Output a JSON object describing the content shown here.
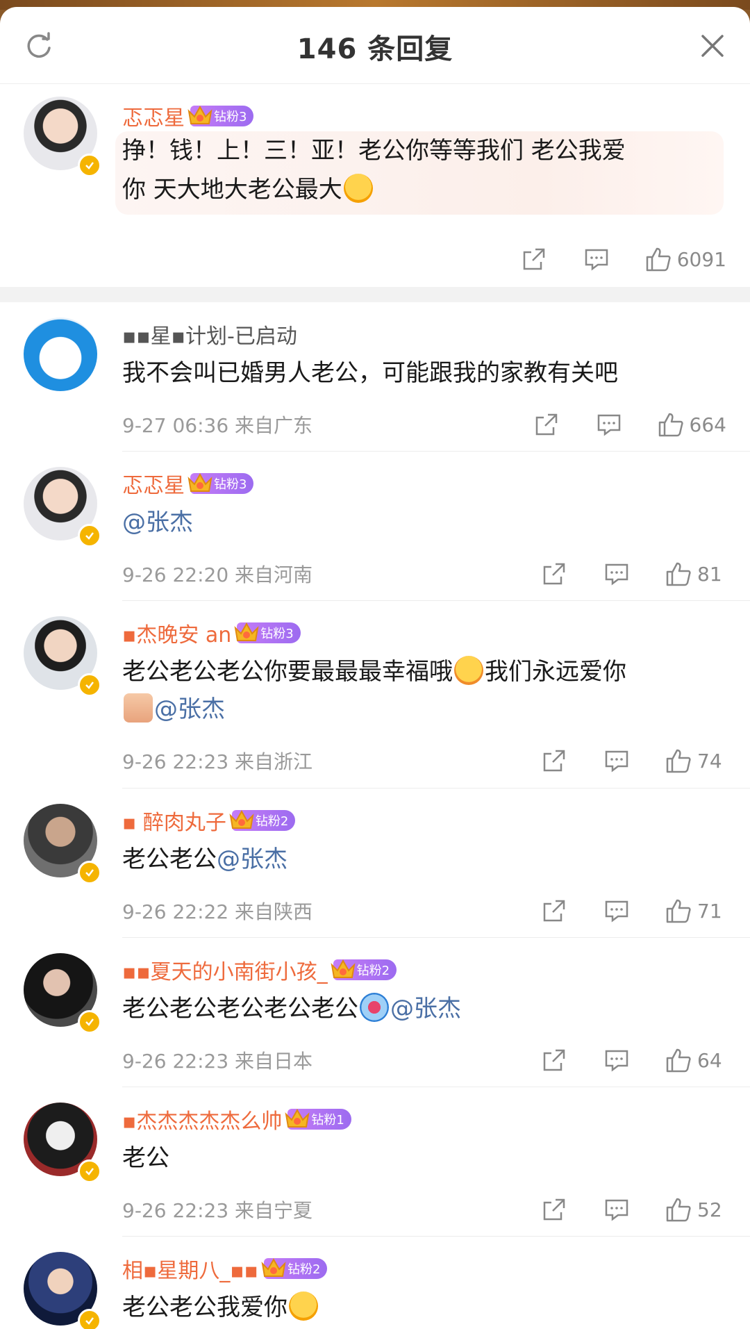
{
  "header": {
    "title": "146 条回复"
  },
  "top_comment": {
    "username": "忑忑星",
    "badge": "钻粉3",
    "text_line1": "挣！钱！上！三！亚！老公你等等我们 老公我爱",
    "text_line2": "你 天大地大老公最大",
    "likes": "6091"
  },
  "comments": [
    {
      "username": "​▪▪星▪计划-已启动",
      "badge": "",
      "text": "我不会叫已婚男人老公，可能跟我的家教有关吧",
      "mention": "",
      "meta": "9-27 06:36 来自广东",
      "likes": "664"
    },
    {
      "username": "忑忑星",
      "badge": "钻粉3",
      "text": "",
      "mention": "@张杰",
      "meta": "9-26 22:20 来自河南",
      "likes": "81"
    },
    {
      "username": "▪杰晚安 an",
      "badge": "钻粉3",
      "text": "老公老公老公你要最最最幸福哦",
      "text2": "我们永远爱你",
      "mention": "@张杰",
      "meta": "9-26 22:23 来自浙江",
      "likes": "74"
    },
    {
      "username": "▪ 醉肉丸子",
      "badge": "钻粉2",
      "text": "老公老公",
      "mention": "@张杰",
      "meta": "9-26 22:22 来自陕西",
      "likes": "71"
    },
    {
      "username": "▪▪夏天的小南街小孩_",
      "badge": "钻粉2",
      "text": "老公老公老公老公老公",
      "mention": "@张杰",
      "meta": "9-26 22:23 来自日本",
      "likes": "64"
    },
    {
      "username": "▪杰杰杰杰杰么帅",
      "badge": "钻粉1",
      "text": "老公",
      "mention": "",
      "meta": "9-26 22:23 来自宁夏",
      "likes": "52"
    },
    {
      "username": "相▪星期八_▪▪",
      "badge": "钻粉2",
      "text": "老公老公我爱你",
      "mention": "",
      "meta": "",
      "likes": ""
    }
  ],
  "colors": {
    "username": "#ee6a3c",
    "mention": "#4a6fa5",
    "verified": "#f5b400",
    "badge": "#b075f3"
  }
}
